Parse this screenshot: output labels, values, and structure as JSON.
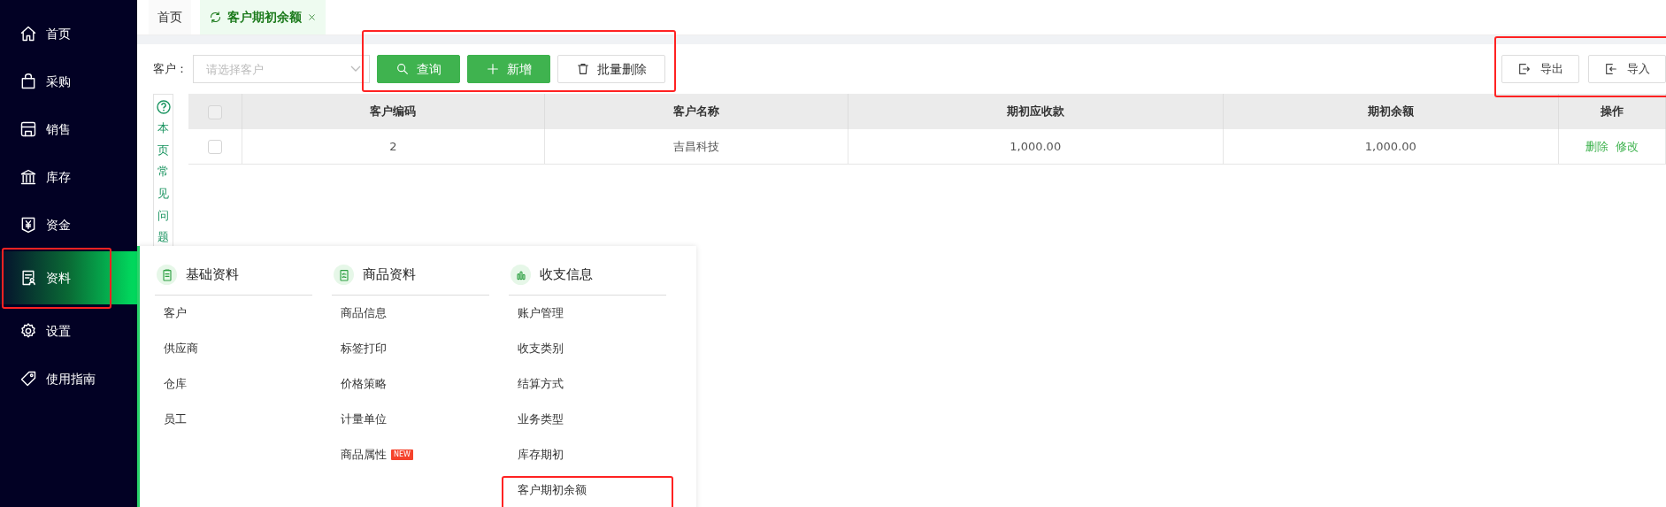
{
  "sidebar": {
    "items": [
      {
        "label": "首页",
        "selected": false,
        "highlighted": false
      },
      {
        "label": "采购",
        "selected": false,
        "highlighted": false
      },
      {
        "label": "销售",
        "selected": false,
        "highlighted": false
      },
      {
        "label": "库存",
        "selected": false,
        "highlighted": false
      },
      {
        "label": "资金",
        "selected": false,
        "highlighted": false
      },
      {
        "label": "资料",
        "selected": true,
        "highlighted": true
      },
      {
        "label": "设置",
        "selected": false,
        "highlighted": false
      },
      {
        "label": "使用指南",
        "selected": false,
        "highlighted": false
      }
    ]
  },
  "tabs": [
    {
      "label": "首页",
      "selected": false
    },
    {
      "label": "客户期初余额",
      "selected": true
    }
  ],
  "filter": {
    "label": "客户：",
    "placeholder": "请选择客户"
  },
  "actions": {
    "highlighted": true,
    "buttons": [
      {
        "label": "查询",
        "kind": "primary"
      },
      {
        "label": "新增",
        "kind": "primary"
      },
      {
        "label": "批量删除",
        "kind": "default"
      }
    ]
  },
  "transfer": {
    "highlighted": true,
    "buttons": [
      {
        "label": "导出"
      },
      {
        "label": "导入"
      }
    ]
  },
  "help": {
    "text": "本页常见问题"
  },
  "table": {
    "select_all": {
      "checked": false,
      "disabled": true
    },
    "columns": [
      "客户编码",
      "客户名称",
      "期初应收款",
      "期初余额",
      "操作"
    ],
    "rows": [
      {
        "checked": false,
        "cells": [
          "2",
          "吉昌科技",
          "1,000.00",
          "1,000.00"
        ],
        "links": [
          "删除",
          "修改"
        ]
      }
    ]
  },
  "menu": {
    "groups": [
      {
        "title": "基础资料",
        "items": [
          {
            "label": "客户",
            "highlighted": false
          },
          {
            "label": "供应商",
            "highlighted": false
          },
          {
            "label": "仓库",
            "highlighted": false
          },
          {
            "label": "员工",
            "highlighted": false
          }
        ]
      },
      {
        "title": "商品资料",
        "items": [
          {
            "label": "商品信息",
            "highlighted": false
          },
          {
            "label": "标签打印",
            "highlighted": false
          },
          {
            "label": "价格策略",
            "highlighted": false
          },
          {
            "label": "计量单位",
            "highlighted": false
          },
          {
            "label": "商品属性",
            "badge": "NEW",
            "highlighted": false
          }
        ]
      },
      {
        "title": "收支信息",
        "items": [
          {
            "label": "账户管理",
            "highlighted": false
          },
          {
            "label": "收支类别",
            "highlighted": false
          },
          {
            "label": "结算方式",
            "highlighted": false
          },
          {
            "label": "业务类型",
            "highlighted": false
          },
          {
            "label": "库存期初",
            "highlighted": false
          },
          {
            "label": "客户期初余额",
            "highlighted": true
          }
        ]
      }
    ]
  }
}
